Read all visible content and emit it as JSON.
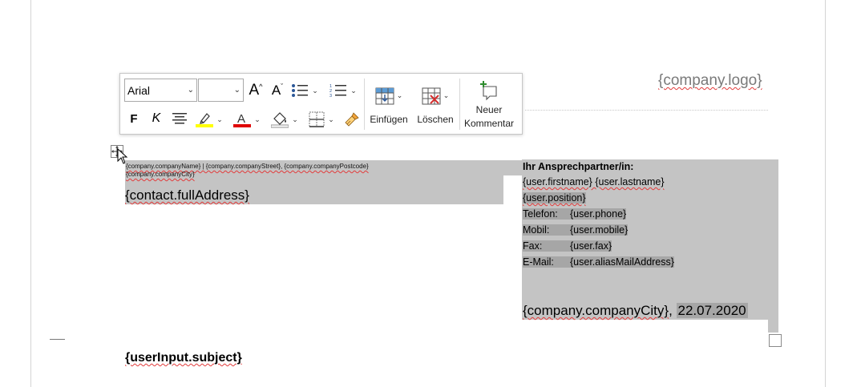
{
  "header": {
    "logo_placeholder": "{company.logo}"
  },
  "toolbar": {
    "font_name": "Arial",
    "font_size": "",
    "grow_font": "A",
    "shrink_font": "A",
    "bold": "F",
    "italic": "K",
    "insert_label": "Einfügen",
    "delete_label": "Löschen",
    "comment_label_line1": "Neuer",
    "comment_label_line2": "Kommentar",
    "colors": {
      "highlight": "#ffff00",
      "font_color": "#e00000",
      "comment_green": "#2e8b2e"
    }
  },
  "address": {
    "sender_line": "{company.companyName} | {company.companyStreet}, {company.companyPostcode}",
    "sender_city": "{company.companyCity}",
    "full_address": "{contact.fullAddress}"
  },
  "contact": {
    "heading": "Ihr Ansprechpartner/in:",
    "name": "{user.firstname} {user.lastname}",
    "position": "{user.position}",
    "rows": [
      {
        "label": "Telefon:",
        "value": "{user.phone}"
      },
      {
        "label": "Mobil:",
        "value": "{user.mobile}"
      },
      {
        "label": "Fax:",
        "value": "{user.fax}"
      },
      {
        "label": "E-Mail:",
        "value": "{user.aliasMailAddress}"
      }
    ],
    "city": "{company.companyCity}",
    "separator": ", ",
    "date": "22.07.2020"
  },
  "body": {
    "subject": "{userInput.subject}"
  }
}
